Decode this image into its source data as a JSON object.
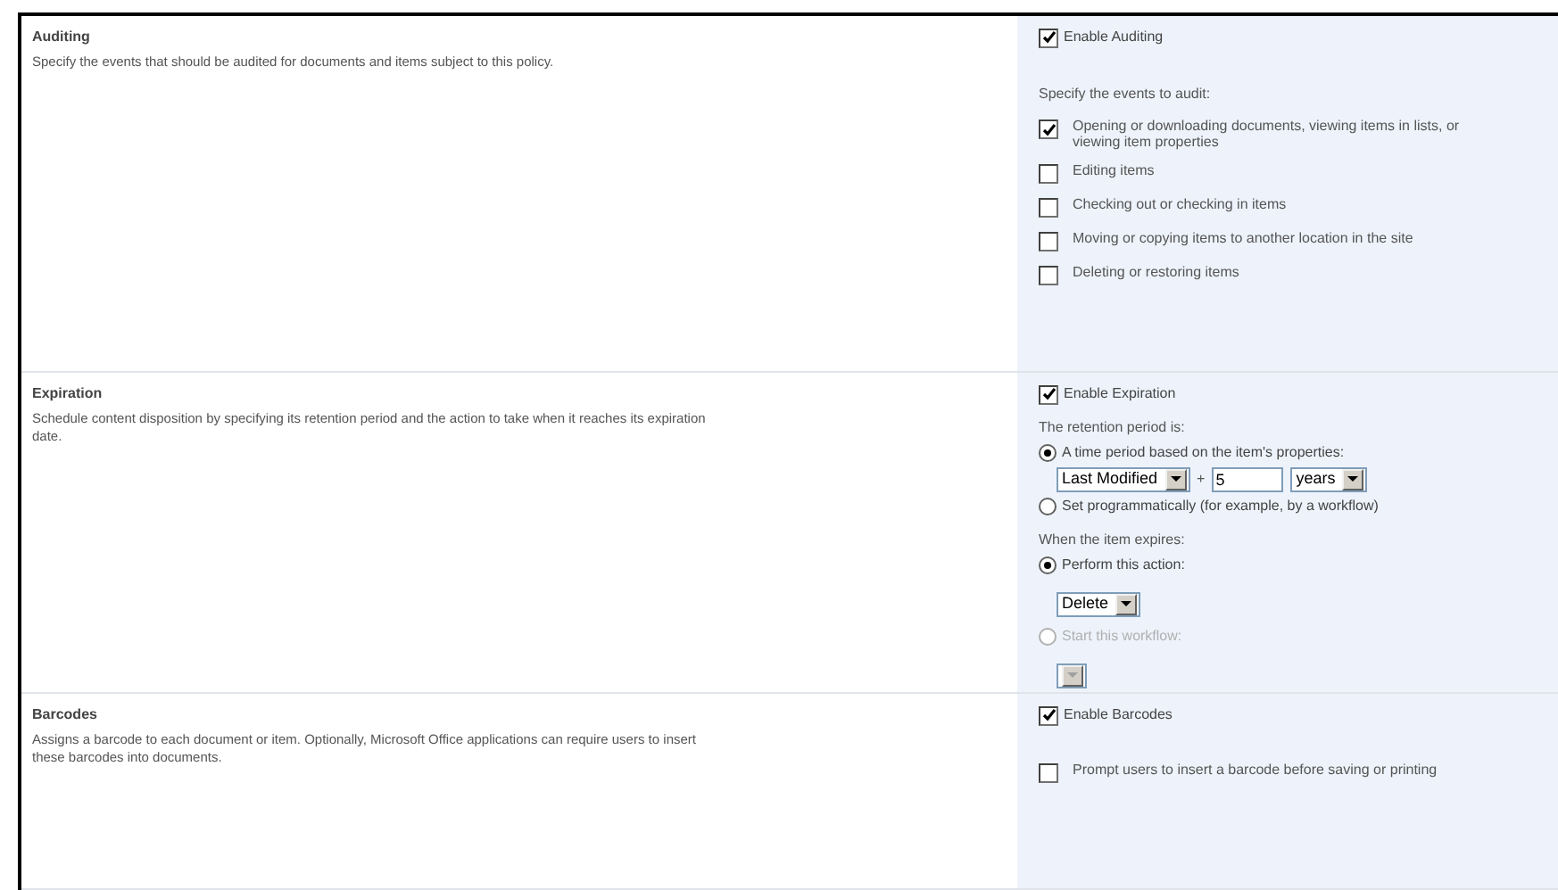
{
  "sections": [
    {
      "title": "Auditing",
      "description": "Specify the events that should be audited for documents and items subject to this policy.",
      "groups": [
        [
          {
            "kind": "checkbox",
            "label": "Enable Auditing",
            "checked": true
          }
        ],
        [
          {
            "kind": "text",
            "text": "Specify the events to audit:"
          },
          {
            "kind": "event",
            "label": "Opening or downloading documents, viewing items in lists, or viewing item properties",
            "checked": true
          },
          {
            "kind": "event",
            "label": "Editing items",
            "checked": false
          },
          {
            "kind": "event",
            "label": "Checking out or checking in items",
            "checked": false
          },
          {
            "kind": "event",
            "label": "Moving or copying items to another location in the site",
            "checked": false
          },
          {
            "kind": "event",
            "label": "Deleting or restoring items",
            "checked": false
          }
        ]
      ]
    },
    {
      "title": "Expiration",
      "description": "Schedule content disposition by specifying its retention period and the action to take when it reaches its expiration date.",
      "groups": [
        [
          {
            "kind": "checkbox",
            "label": "Enable Expiration",
            "checked": true
          }
        ],
        [
          {
            "kind": "text",
            "text": "The retention period is:"
          },
          {
            "kind": "radio",
            "label": "A time period based on the item's properties:",
            "selected": true,
            "disabled": false
          },
          {
            "kind": "retention",
            "base": "Last Modified",
            "operator": "+",
            "amount": "5",
            "unit": "years"
          },
          {
            "kind": "radio",
            "label": "Set programmatically (for example, by a workflow)",
            "selected": false,
            "disabled": false
          }
        ],
        [
          {
            "kind": "text",
            "text": "When the item expires:"
          },
          {
            "kind": "radio",
            "label": "Perform this action:",
            "selected": true,
            "disabled": false
          },
          {
            "kind": "dropdown",
            "value": "Delete",
            "disabled": false
          },
          {
            "kind": "radio",
            "label": "Start this workflow:",
            "selected": false,
            "disabled": true
          },
          {
            "kind": "dropdown",
            "disabled": true
          }
        ]
      ]
    },
    {
      "title": "Barcodes",
      "description": "Assigns a barcode to each document or item. Optionally, Microsoft Office applications can require users to insert these barcodes into documents.",
      "groups": [
        [
          {
            "kind": "checkbox",
            "label": "Enable Barcodes",
            "checked": true
          }
        ],
        [
          {
            "kind": "event",
            "label": "Prompt users to insert a barcode before saving or printing",
            "checked": false
          }
        ]
      ]
    }
  ]
}
